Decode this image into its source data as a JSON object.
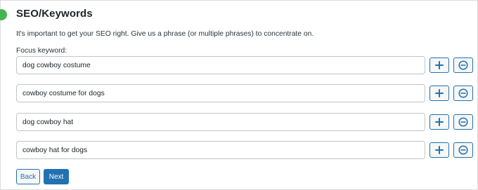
{
  "section": {
    "title": "SEO/Keywords",
    "intro": "It's important to get your SEO right. Give us a phrase (or multiple phrases) to concentrate on.",
    "focus_label": "Focus keyword:"
  },
  "keywords": [
    {
      "value": "dog cowboy costume"
    },
    {
      "value": "cowboy costume for dogs"
    },
    {
      "value": "dog cowboy hat"
    },
    {
      "value": "cowboy hat for dogs"
    }
  ],
  "row_controls": {
    "add_icon": "plus-icon",
    "remove_icon": "minus-circle-icon"
  },
  "nav": {
    "back_label": "Back",
    "next_label": "Next"
  },
  "colors": {
    "accent": "#2271b1",
    "step_complete": "#46b450",
    "border": "#c3c4c7"
  }
}
